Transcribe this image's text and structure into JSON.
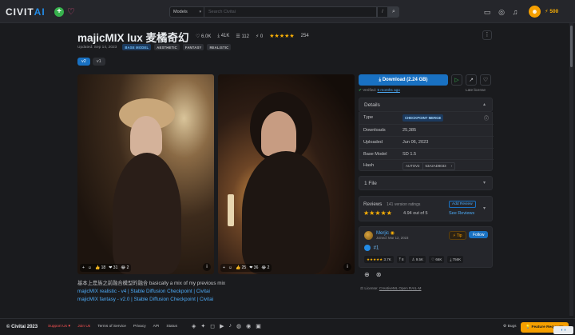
{
  "topbar": {
    "logo_main": "CIVIT",
    "logo_accent": "AI",
    "search_select": "Models",
    "search_placeholder": "Search Civitai",
    "slash": "/",
    "buzz": "500"
  },
  "model": {
    "title": "majicMIX lux 麦橘奇幻",
    "likes": "6.0K",
    "downloads": "41K",
    "collections": "112",
    "tips": "0",
    "rating_count": "254",
    "updated": "Updated: Sep 14, 2023",
    "badges": [
      "BASE MODEL",
      "AESTHETIC",
      "FANTASY",
      "REALISTIC"
    ],
    "versions": [
      "v2",
      "v1"
    ]
  },
  "images": [
    {
      "reactions": [
        "+",
        "☺",
        "👍 18",
        "❤ 31",
        "😂 2"
      ],
      "info": "i"
    },
    {
      "reactions": [
        "+",
        "☺",
        "👍 25",
        "❤ 36",
        "😂 2"
      ],
      "info": "i"
    }
  ],
  "description": {
    "line1": "基本上是族之前融合模型的融合 basically a mix of my previous mix",
    "line2": "majicMIX realistic - v4 | Stable Diffusion Checkpoint | Civitai",
    "line3": "majicMIX fantasy - v2.0 | Stable Diffusion Checkpoint | Civitai"
  },
  "side": {
    "download_label": "Download (2.24 GB)",
    "verified_prefix": "Verified:",
    "verified_time": "5 months ago",
    "late_label": "Late license",
    "details_title": "Details",
    "type_label": "Type",
    "type_value": "CHECKPOINT MERGE",
    "downloads_label": "Downloads",
    "downloads_value": "25,385",
    "uploaded_label": "Uploaded",
    "uploaded_value": "Jun 06, 2023",
    "base_label": "Base Model",
    "base_value": "SD 1.5",
    "hash_label": "Hash",
    "hash_algo": "AUTOV2",
    "hash_value": "53A2AD8033",
    "files_title": "1 File",
    "reviews_title": "Reviews",
    "reviews_count": "141 version ratings",
    "reviews_avg": "4.94 out of 5",
    "add_review": "Add Review",
    "see_reviews": "See Reviews",
    "creator_name": "Merjic",
    "creator_since": "Joined: Mar 12, 2023",
    "tip_label": "Tip",
    "follow_label": "Follow",
    "rank": "#1",
    "creator_stats": [
      "3.7K",
      "8",
      "9.5K",
      "66K",
      "756K"
    ],
    "license_prefix": "License:",
    "license_value": "CreativeML Open RAIL-M"
  },
  "footer": {
    "copyright": "© Civitai 2023",
    "links": [
      "Support Us ♥",
      "Join Us",
      "Terms of Service",
      "Privacy",
      "API",
      "Status"
    ],
    "bugs": "Bugs",
    "feature": "Feature Requests"
  },
  "colors": {
    "accent": "#1971c2",
    "star": "#fab005",
    "link": "#4dabf7"
  }
}
